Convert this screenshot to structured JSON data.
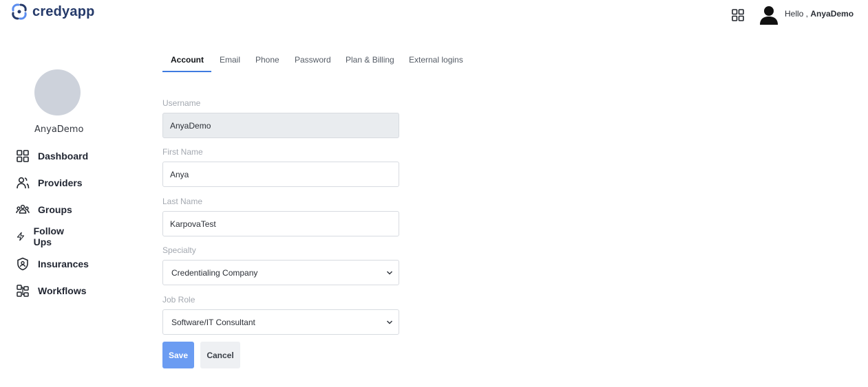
{
  "brand": {
    "name": "credyapp",
    "colors": {
      "primary": "#3e7be0",
      "logo_blue": "#253a6a",
      "logo_accent": "#5b8def"
    }
  },
  "header": {
    "greeting_prefix": "Hello ,",
    "user_name": "AnyaDemo",
    "apps_icon": "grid-icon",
    "avatar_icon": "user-icon"
  },
  "sidebar": {
    "profile_name": "AnyaDemo",
    "items": [
      {
        "label": "Dashboard",
        "icon": "grid-icon"
      },
      {
        "label": "Providers",
        "icon": "users-icon"
      },
      {
        "label": "Groups",
        "icon": "group-icon"
      },
      {
        "label": "Follow Ups",
        "icon": "lightning-icon"
      },
      {
        "label": "Insurances",
        "icon": "shield-icon"
      },
      {
        "label": "Workflows",
        "icon": "workflow-icon"
      }
    ]
  },
  "tabs": [
    {
      "label": "Account",
      "active": true
    },
    {
      "label": "Email"
    },
    {
      "label": "Phone"
    },
    {
      "label": "Password"
    },
    {
      "label": "Plan & Billing"
    },
    {
      "label": "External logins"
    }
  ],
  "form": {
    "username": {
      "label": "Username",
      "value": "AnyaDemo"
    },
    "first_name": {
      "label": "First Name",
      "value": "Anya"
    },
    "last_name": {
      "label": "Last Name",
      "value": "KarpovaTest"
    },
    "specialty": {
      "label": "Specialty",
      "value": "Credentialing Company"
    },
    "job_role": {
      "label": "Job Role",
      "value": "Software/IT Consultant"
    },
    "save_label": "Save",
    "cancel_label": "Cancel"
  }
}
